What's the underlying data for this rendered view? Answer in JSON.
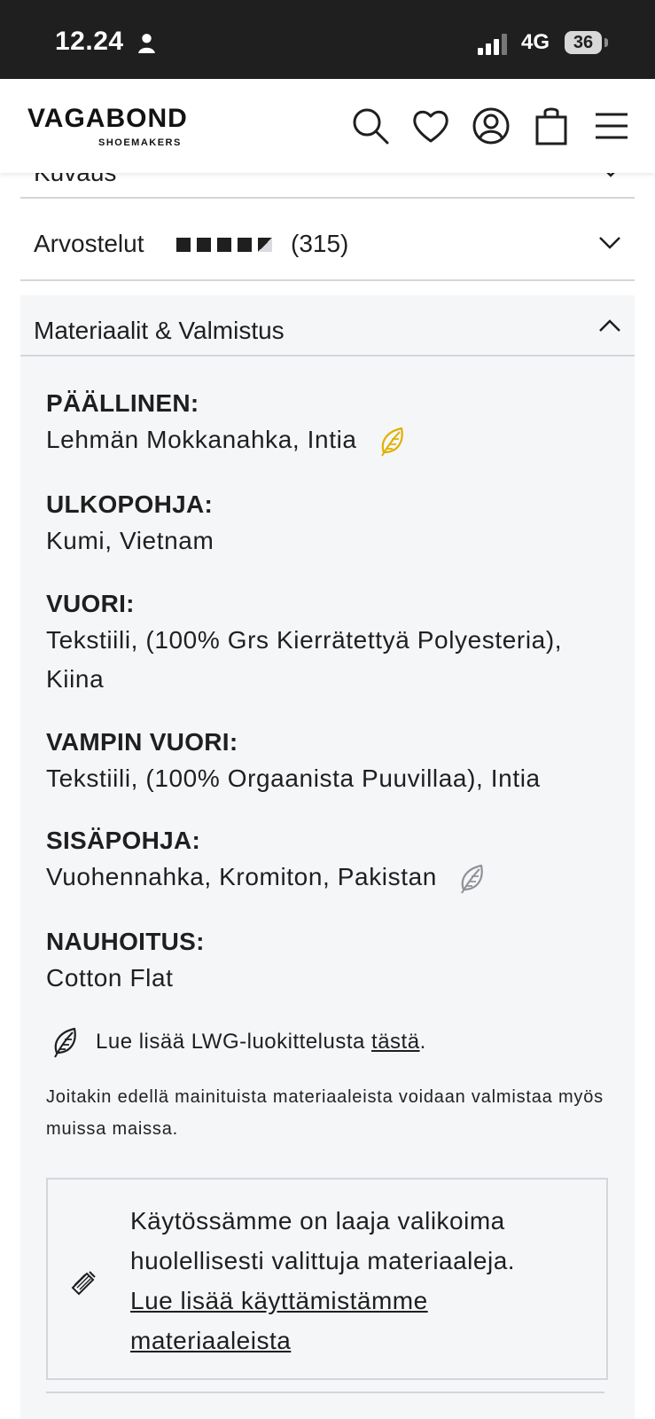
{
  "status_bar": {
    "time": "12.24",
    "person_icon": "person-icon",
    "network": "4G",
    "battery": "36"
  },
  "header": {
    "logo_main": "VAGABOND",
    "logo_sub": "SHOEMAKERS",
    "icons": [
      "search-icon",
      "heart-icon",
      "account-icon",
      "bag-icon",
      "menu-icon"
    ]
  },
  "accordion": {
    "collapsed_top_label": "Kuvaus",
    "reviews": {
      "label": "Arvostelut",
      "rating": 4.5,
      "count": "(315)"
    },
    "materials_label": "Materiaalit & Valmistus"
  },
  "materials": [
    {
      "title": "PÄÄLLINEN:",
      "value": "Lehmän Mokkanahka, Intia",
      "leaf": "yellow"
    },
    {
      "title": "ULKOPOHJA:",
      "value": "Kumi, Vietnam"
    },
    {
      "title": "VUORI:",
      "value": "Tekstiili, (100% Grs Kierrätettyä Polyesteria), Kiina"
    },
    {
      "title": "VAMPIN VUORI:",
      "value": "Tekstiili, (100% Orgaanista Puuvillaa), Intia"
    },
    {
      "title": "SISÄPOHJA:",
      "value": "Vuohennahka, Kromiton, Pakistan",
      "leaf": "gray"
    },
    {
      "title": "NAUHOITUS:",
      "value": "Cotton Flat"
    }
  ],
  "lwg": {
    "prefix": "Lue lisää LWG-luokittelusta ",
    "link": "tästä",
    "suffix": "."
  },
  "disclaimer": "Joitakin edellä mainituista materiaaleista voidaan valmistaa myös muissa maissa.",
  "info_box": {
    "text": "Käytössämme on laaja valikoima huolellisesti valittuja materiaaleja.",
    "link": "Lue lisää käyttämistämme materiaaleista"
  },
  "colors": {
    "status_bar": "#1f1f1f",
    "panel_bg": "#f5f6f8",
    "divider": "#d4d6dc",
    "leaf_yellow": "#e0b100",
    "leaf_gray": "#8f9399"
  }
}
